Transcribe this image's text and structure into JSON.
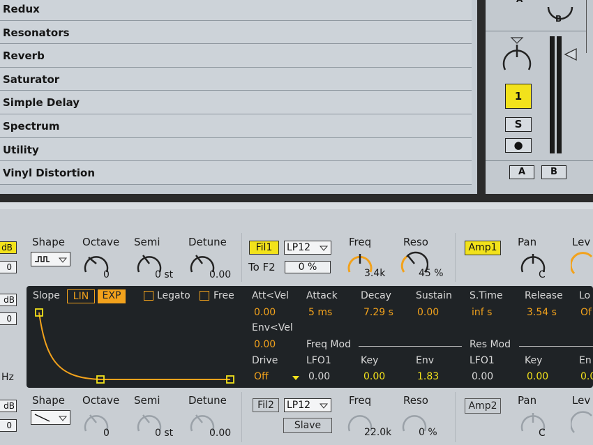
{
  "browser": {
    "items": [
      "Redux",
      "Resonators",
      "Reverb",
      "Saturator",
      "Simple Delay",
      "Spectrum",
      "Utility",
      "Vinyl Distortion"
    ]
  },
  "mixer": {
    "top_label_a": "A",
    "top_label_b": "B",
    "track_number": "1",
    "solo": "S",
    "arm": "●",
    "crossfade_a": "A",
    "crossfade_b": "B"
  },
  "osc1": {
    "unit_top": "dB",
    "unit_top_val": "0",
    "shape_label": "Shape",
    "octave_label": "Octave",
    "octave_val": "0",
    "semi_label": "Semi",
    "semi_val": "0 st",
    "detune_label": "Detune",
    "detune_val": "0.00"
  },
  "fil1": {
    "button": "Fil1",
    "type": "LP12",
    "to_f2_label": "To F2",
    "to_f2_val": "0 %",
    "freq_label": "Freq",
    "freq_val": "3.4k",
    "reso_label": "Reso",
    "reso_val": "45 %"
  },
  "amp1": {
    "button": "Amp1",
    "pan_label": "Pan",
    "pan_val": "C",
    "level_label": "Lev"
  },
  "env": {
    "slope_label": "Slope",
    "lin": "LIN",
    "exp": "EXP",
    "legato": "Legato",
    "free": "Free",
    "att_vel_label": "Att<Vel",
    "att_vel_val": "0.00",
    "attack_label": "Attack",
    "attack_val": "5 ms",
    "decay_label": "Decay",
    "decay_val": "7.29 s",
    "sustain_label": "Sustain",
    "sustain_val": "0.00",
    "stime_label": "S.Time",
    "stime_val": "inf s",
    "release_label": "Release",
    "release_val": "3.54 s",
    "loop_label": "Lo",
    "loop_val": "Of",
    "env_vel_label": "Env<Vel",
    "env_vel_val": "0.00",
    "freq_mod_label": "Freq Mod",
    "res_mod_label": "Res Mod",
    "drive_label": "Drive",
    "drive_val": "Off",
    "fm_lfo1_label": "LFO1",
    "fm_lfo1_val": "0.00",
    "fm_key_label": "Key",
    "fm_key_val": "0.00",
    "fm_env_label": "Env",
    "fm_env_val": "1.83",
    "rm_lfo1_label": "LFO1",
    "rm_lfo1_val": "0.00",
    "rm_key_label": "Key",
    "rm_key_val": "0.00",
    "rm_env_label": "En",
    "rm_env_val": "0.0"
  },
  "side": {
    "db_mid": "dB",
    "zero_mid": "0",
    "hz": "Hz"
  },
  "osc2": {
    "unit_top": "dB",
    "unit_top_val": "0",
    "shape_label": "Shape",
    "octave_label": "Octave",
    "octave_val": "0",
    "semi_label": "Semi",
    "semi_val": "0 st",
    "detune_label": "Detune",
    "detune_val": "0.00"
  },
  "fil2": {
    "button": "Fil2",
    "type": "LP12",
    "slave": "Slave",
    "freq_label": "Freq",
    "freq_val": "22.0k",
    "reso_label": "Reso",
    "reso_val": "0 %"
  },
  "amp2": {
    "button": "Amp2",
    "pan_label": "Pan",
    "pan_val": "C",
    "level_label": "Lev"
  },
  "colors": {
    "accent": "#f2a21c",
    "yellow": "#f2e21b",
    "panel": "#1f2326"
  }
}
